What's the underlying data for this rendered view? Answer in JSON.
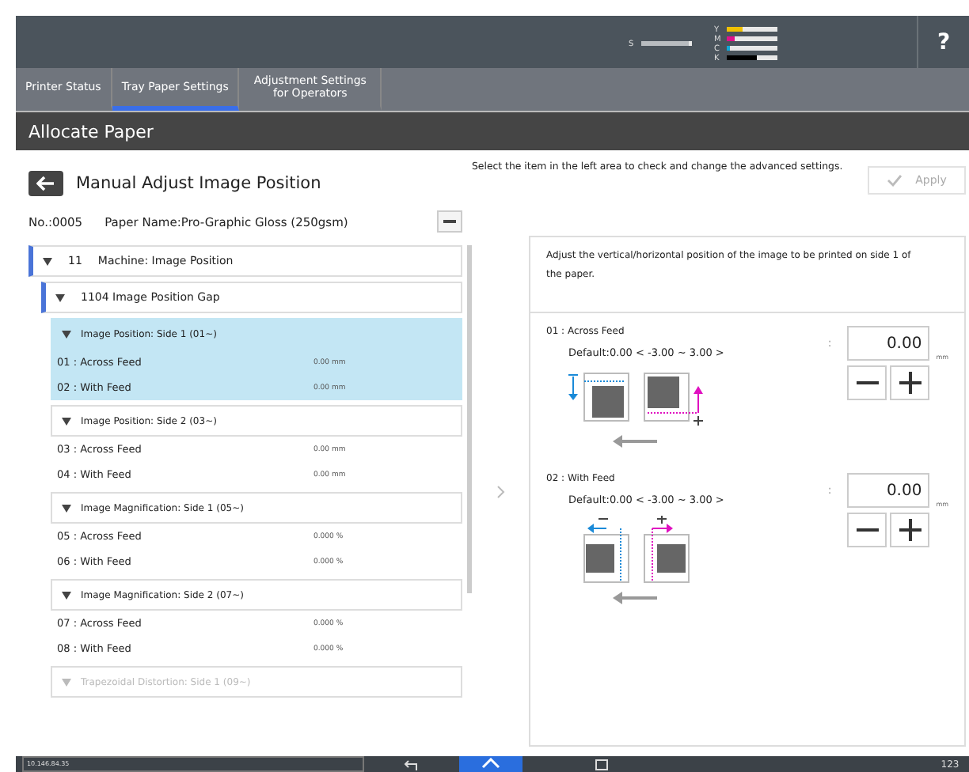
{
  "toner": [
    {
      "label": "S",
      "level": 0.95,
      "color": "#b8bcc0"
    },
    {
      "label": "Y",
      "level": 0.3,
      "color": "#f0c000"
    },
    {
      "label": "M",
      "level": 0.15,
      "color": "#e0108a"
    },
    {
      "label": "C",
      "level": 0.06,
      "color": "#10a8d8"
    },
    {
      "label": "K",
      "level": 0.6,
      "color": "#000000"
    }
  ],
  "help": "?",
  "tabs": [
    {
      "label": "Printer Status",
      "selected": false
    },
    {
      "label": "Tray Paper Settings",
      "selected": true
    },
    {
      "label": "Adjustment Settings for Operators",
      "selected": false
    }
  ],
  "page_title": "Allocate Paper",
  "header": {
    "title": "Manual Adjust Image Position",
    "instruction": "Select the item in the left area to check and change the advanced settings.",
    "apply": {
      "label": "Apply",
      "disabled": true
    }
  },
  "paper": {
    "number": "No.:0005",
    "name": "Paper Name:Pro-Graphic Gloss (250gsm)"
  },
  "tree": [
    {
      "number": "11",
      "label": "Machine: Image Position",
      "expanded": true,
      "children": [
        {
          "label": "1104 Image Position Gap",
          "expanded": true,
          "groups": [
            {
              "label": "Image Position: Side 1 (01~)",
              "selected": true,
              "faded": false,
              "items": [
                {
                  "label": "01 : Across Feed",
                  "value": "0.00 mm"
                },
                {
                  "label": "02 : With Feed",
                  "value": "0.00 mm"
                }
              ]
            },
            {
              "label": "Image Position: Side 2 (03~)",
              "selected": false,
              "faded": false,
              "items": [
                {
                  "label": "03 : Across Feed",
                  "value": "0.00 mm"
                },
                {
                  "label": "04 : With Feed",
                  "value": "0.00 mm"
                }
              ]
            },
            {
              "label": "Image Magnification: Side 1 (05~)",
              "selected": false,
              "faded": false,
              "items": [
                {
                  "label": "05 : Across Feed",
                  "value": "0.000 %"
                },
                {
                  "label": "06 : With Feed",
                  "value": "0.000 %"
                }
              ]
            },
            {
              "label": "Image Magnification: Side 2 (07~)",
              "selected": false,
              "faded": false,
              "items": [
                {
                  "label": "07 : Across Feed",
                  "value": "0.000 %"
                },
                {
                  "label": "08 : With Feed",
                  "value": "0.000 %"
                }
              ]
            },
            {
              "label": "Trapezoidal Distortion: Side 1 (09~)",
              "selected": false,
              "faded": true
            }
          ]
        }
      ]
    }
  ],
  "detail": {
    "description": "Adjust the vertical/horizontal position of the image to be printed on side 1 of the paper.",
    "settings": [
      {
        "kind": "across",
        "label": "01 : Across Feed",
        "colon": ":",
        "value": "0.00",
        "unit": "mm",
        "range": "Default:0.00  < -3.00  ~  3.00 >"
      },
      {
        "kind": "with",
        "label": "02 : With Feed",
        "colon": ":",
        "value": "0.00",
        "unit": "mm",
        "range": "Default:0.00  < -3.00  ~  3.00 >"
      }
    ]
  },
  "status_bar": {
    "address": "10.146.84.35",
    "keyboard": "123"
  }
}
